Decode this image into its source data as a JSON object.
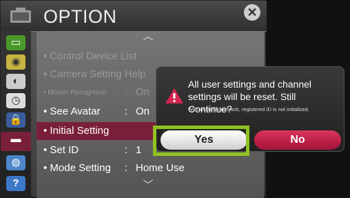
{
  "panel": {
    "title": "OPTION",
    "icons": [
      "tv-icon",
      "close-icon"
    ],
    "close_label": "✕"
  },
  "sidebar": {
    "items": [
      {
        "icon": "picture-icon",
        "glyph": "▭"
      },
      {
        "icon": "sound-icon",
        "glyph": "◉"
      },
      {
        "icon": "channel-icon",
        "glyph": "◐"
      },
      {
        "icon": "time-icon",
        "glyph": "◷"
      },
      {
        "icon": "lock-icon",
        "glyph": "🔒"
      },
      {
        "icon": "option-icon",
        "glyph": "▬"
      },
      {
        "icon": "network-icon",
        "glyph": "◍"
      },
      {
        "icon": "support-icon",
        "glyph": "?"
      }
    ],
    "active_index": 5
  },
  "options": [
    {
      "label": "• Control Device List",
      "colon": "",
      "value": "",
      "state": "dim"
    },
    {
      "label": "• Camera Setting Help",
      "colon": "",
      "value": "",
      "state": "dim"
    },
    {
      "label": "• Motion Recognition",
      "colon": ":",
      "value": "On",
      "state": "dim-tiny"
    },
    {
      "label": "• See Avatar",
      "colon": ":",
      "value": "On",
      "state": "normal"
    },
    {
      "label": "• Initial Setting",
      "colon": "",
      "value": "",
      "state": "selected"
    },
    {
      "label": "• Set ID",
      "colon": ":",
      "value": "1",
      "state": "normal"
    },
    {
      "label": "• Mode Setting",
      "colon": ":",
      "value": "Home Use",
      "state": "normal"
    }
  ],
  "scroll": {
    "up": "︿",
    "down": "﹀"
  },
  "dialog": {
    "message": "All user settings and channel settings will be reset. Still Continue?",
    "note": "With unstable network, registered ID is not initialized.",
    "yes_label": "Yes",
    "no_label": "No",
    "focused_button": "Yes",
    "colors": {
      "yes_focus": "#8fc220",
      "no": "#c4234a",
      "warning": "#d6264f"
    }
  }
}
